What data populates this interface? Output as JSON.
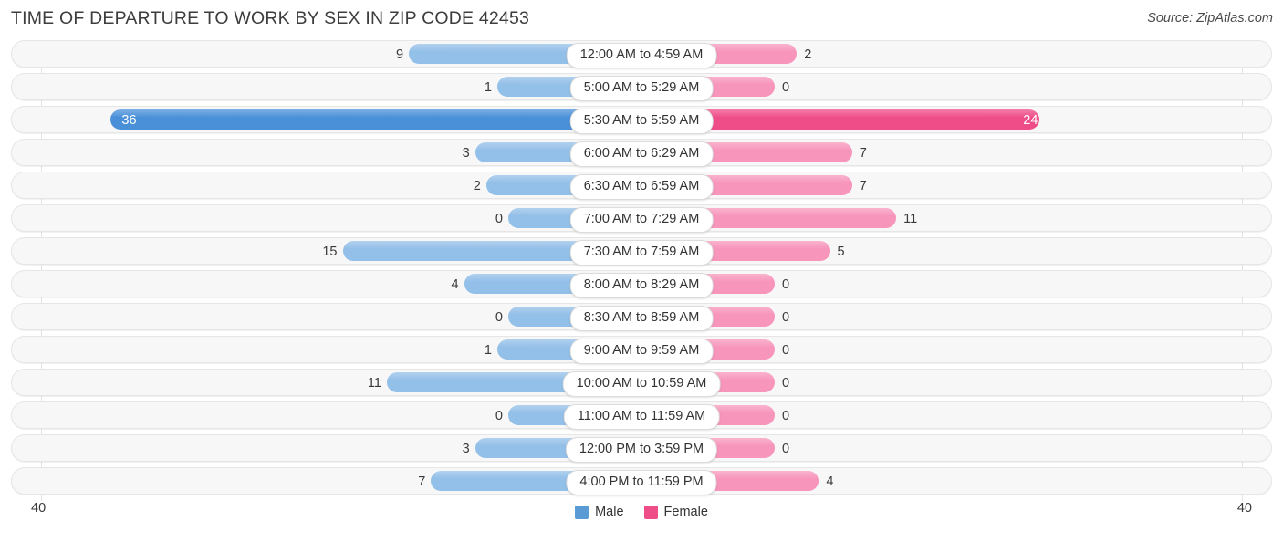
{
  "header": {
    "title": "TIME OF DEPARTURE TO WORK BY SEX IN ZIP CODE 42453",
    "source": "Source: ZipAtlas.com"
  },
  "legend": {
    "male_label": "Male",
    "female_label": "Female",
    "male_color": "#5b9bd5",
    "female_color": "#ef4d88"
  },
  "axis": {
    "left_max": "40",
    "right_max": "40"
  },
  "chart_data": {
    "type": "bar",
    "subtype": "diverging-bar",
    "title": "TIME OF DEPARTURE TO WORK BY SEX IN ZIP CODE 42453",
    "xlabel": "",
    "ylabel": "",
    "xlim": [
      40,
      40
    ],
    "grid": true,
    "legend_position": "bottom-center",
    "categories": [
      "12:00 AM to 4:59 AM",
      "5:00 AM to 5:29 AM",
      "5:30 AM to 5:59 AM",
      "6:00 AM to 6:29 AM",
      "6:30 AM to 6:59 AM",
      "7:00 AM to 7:29 AM",
      "7:30 AM to 7:59 AM",
      "8:00 AM to 8:29 AM",
      "8:30 AM to 8:59 AM",
      "9:00 AM to 9:59 AM",
      "10:00 AM to 10:59 AM",
      "11:00 AM to 11:59 AM",
      "12:00 PM to 3:59 PM",
      "4:00 PM to 11:59 PM"
    ],
    "series": [
      {
        "name": "Male",
        "side": "left",
        "color": "#93c0e8",
        "highlight_color": "#4a90d9",
        "values": [
          9,
          1,
          36,
          3,
          2,
          0,
          15,
          4,
          0,
          1,
          11,
          0,
          3,
          7
        ]
      },
      {
        "name": "Female",
        "side": "right",
        "color": "#f795bb",
        "highlight_color": "#ef4d88",
        "values": [
          2,
          0,
          24,
          7,
          7,
          11,
          5,
          0,
          0,
          0,
          0,
          0,
          0,
          4
        ]
      }
    ],
    "highlight_row_index": 2
  },
  "rows": [
    {
      "label": "12:00 AM to 4:59 AM",
      "male": "9",
      "female": "2"
    },
    {
      "label": "5:00 AM to 5:29 AM",
      "male": "1",
      "female": "0"
    },
    {
      "label": "5:30 AM to 5:59 AM",
      "male": "36",
      "female": "24"
    },
    {
      "label": "6:00 AM to 6:29 AM",
      "male": "3",
      "female": "7"
    },
    {
      "label": "6:30 AM to 6:59 AM",
      "male": "2",
      "female": "7"
    },
    {
      "label": "7:00 AM to 7:29 AM",
      "male": "0",
      "female": "11"
    },
    {
      "label": "7:30 AM to 7:59 AM",
      "male": "15",
      "female": "5"
    },
    {
      "label": "8:00 AM to 8:29 AM",
      "male": "4",
      "female": "0"
    },
    {
      "label": "8:30 AM to 8:59 AM",
      "male": "0",
      "female": "0"
    },
    {
      "label": "9:00 AM to 9:59 AM",
      "male": "1",
      "female": "0"
    },
    {
      "label": "10:00 AM to 10:59 AM",
      "male": "11",
      "female": "0"
    },
    {
      "label": "11:00 AM to 11:59 AM",
      "male": "0",
      "female": "0"
    },
    {
      "label": "12:00 PM to 3:59 PM",
      "male": "3",
      "female": "0"
    },
    {
      "label": "4:00 PM to 11:59 PM",
      "male": "7",
      "female": "4"
    }
  ]
}
